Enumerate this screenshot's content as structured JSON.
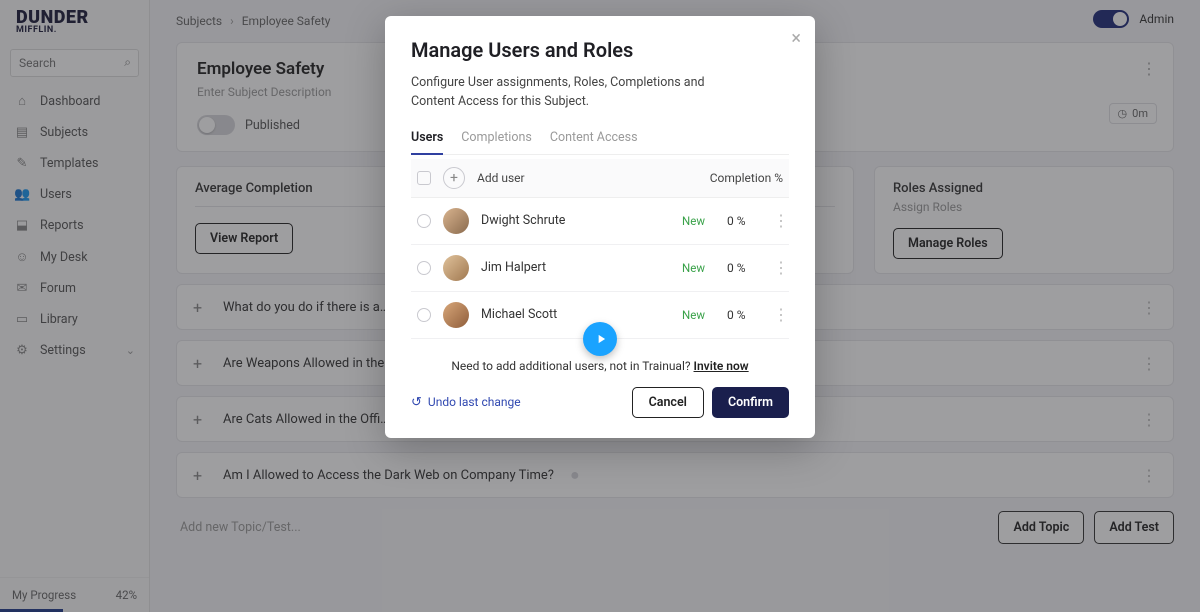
{
  "brand": {
    "name": "DUNDER",
    "name2": "MIFFLIN."
  },
  "search": {
    "placeholder": "Search"
  },
  "nav": [
    {
      "icon": "⌂",
      "label": "Dashboard"
    },
    {
      "icon": "▤",
      "label": "Subjects"
    },
    {
      "icon": "✎",
      "label": "Templates"
    },
    {
      "icon": "👥",
      "label": "Users"
    },
    {
      "icon": "⬓",
      "label": "Reports"
    },
    {
      "icon": "☺",
      "label": "My Desk"
    },
    {
      "icon": "✉",
      "label": "Forum"
    },
    {
      "icon": "▭",
      "label": "Library"
    },
    {
      "icon": "⚙",
      "label": "Settings"
    }
  ],
  "progress": {
    "label": "My Progress",
    "pct": "42%"
  },
  "crumbs": {
    "root": "Subjects",
    "leaf": "Employee Safety"
  },
  "admin": {
    "label": "Admin"
  },
  "subject": {
    "title": "Employee Safety",
    "desc_placeholder": "Enter Subject Description",
    "published_label": "Published",
    "time_chip": "0m"
  },
  "average": {
    "label": "Average Completion",
    "view_report": "View Report"
  },
  "roles": {
    "label": "Roles Assigned",
    "sub": "Assign Roles",
    "manage": "Manage Roles"
  },
  "topics": [
    "What do you do if there is a…",
    "Are Weapons Allowed in the…",
    "Are Cats Allowed in the Offi…",
    "Am I Allowed to Access the Dark Web on Company Time?"
  ],
  "addnew": {
    "placeholder": "Add new Topic/Test...",
    "add_topic": "Add Topic",
    "add_test": "Add Test"
  },
  "modal": {
    "title": "Manage Users and Roles",
    "subtitle": "Configure User assignments, Roles, Completions and Content Access for this Subject.",
    "tabs": {
      "users": "Users",
      "completions": "Completions",
      "content": "Content Access"
    },
    "header": {
      "add_user": "Add user",
      "completion": "Completion %"
    },
    "users": [
      {
        "name": "Dwight Schrute",
        "status": "New",
        "pct": "0 %"
      },
      {
        "name": "Jim Halpert",
        "status": "New",
        "pct": "0 %"
      },
      {
        "name": "Michael Scott",
        "status": "New",
        "pct": "0 %"
      }
    ],
    "invite_text": "Need to add additional users, not in Trainual? ",
    "invite_link": "Invite now",
    "undo": "Undo last change",
    "cancel": "Cancel",
    "confirm": "Confirm"
  }
}
